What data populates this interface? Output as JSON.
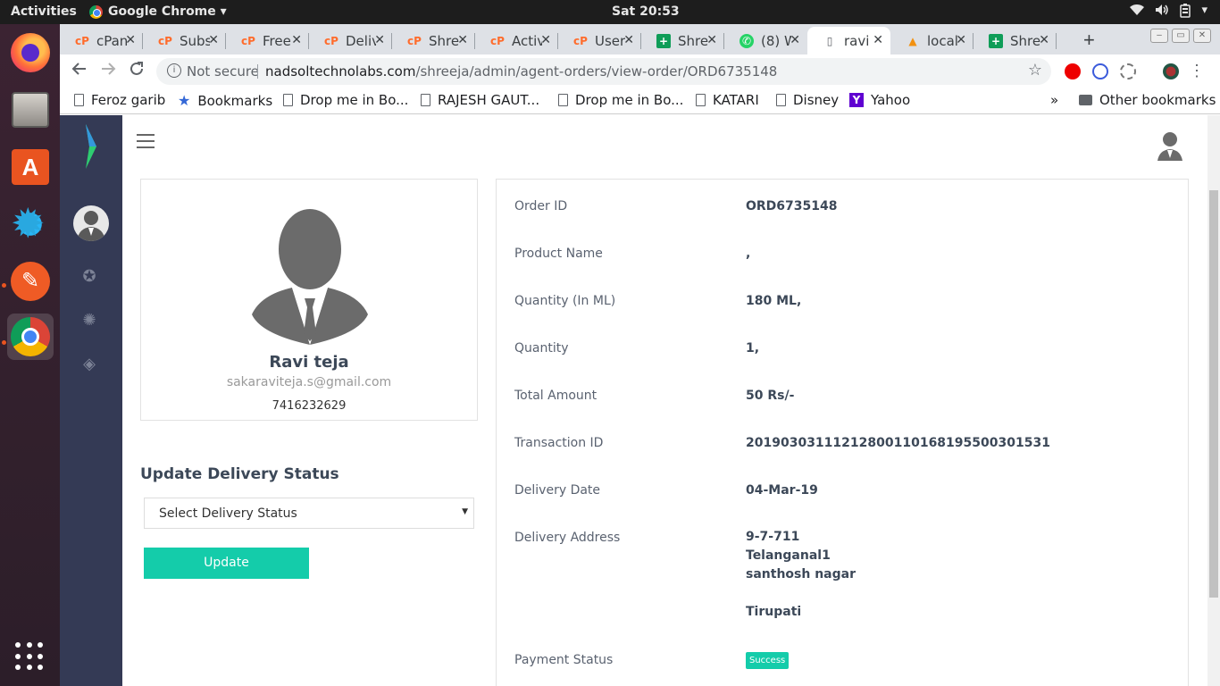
{
  "topbar": {
    "activities": "Activities",
    "app_name": "Google Chrome ▾",
    "clock": "Sat 20:53",
    "tray_icons": [
      "wifi-icon",
      "volume-icon",
      "battery-icon"
    ]
  },
  "tabs": [
    {
      "label": "cPan",
      "icon": "cpanel-icon"
    },
    {
      "label": "Subs",
      "icon": "cpanel-icon"
    },
    {
      "label": "Free",
      "icon": "cpanel-icon"
    },
    {
      "label": "Deliv",
      "icon": "cpanel-icon"
    },
    {
      "label": "Shre",
      "icon": "cpanel-icon"
    },
    {
      "label": "Activ",
      "icon": "cpanel-icon"
    },
    {
      "label": "User",
      "icon": "cpanel-icon"
    },
    {
      "label": "Shre",
      "icon": "sheets-icon"
    },
    {
      "label": "(8) W",
      "icon": "whatsapp-icon"
    },
    {
      "label": "ravi",
      "icon": "page-icon",
      "active": true
    },
    {
      "label": "local",
      "icon": "phpmyadmin-icon"
    },
    {
      "label": "Shre",
      "icon": "sheets-icon"
    }
  ],
  "omnibox": {
    "security": "Not secure",
    "domain": "nadsoltechnolabs.com",
    "path": "/shreeja/admin/agent-orders/view-order/ORD6735148"
  },
  "bookmarks": {
    "items": [
      {
        "label": "Feroz garib",
        "icon": "page-icon"
      },
      {
        "label": "Bookmarks",
        "icon": "star-icon"
      },
      {
        "label": "Drop me in Bo...",
        "icon": "page-icon"
      },
      {
        "label": "RAJESH GAUT...",
        "icon": "page-icon"
      },
      {
        "label": "Drop me in Bo...",
        "icon": "page-icon"
      },
      {
        "label": "KATARI",
        "icon": "page-icon"
      },
      {
        "label": "Disney",
        "icon": "page-icon"
      },
      {
        "label": "Yahoo",
        "icon": "yahoo-icon"
      }
    ],
    "overflow": "»",
    "other": "Other bookmarks"
  },
  "profile": {
    "name": "Ravi teja",
    "email": "sakaraviteja.s@gmail.com",
    "phone": "7416232629"
  },
  "delivery": {
    "title": "Update Delivery Status",
    "select_value": "Select Delivery Status",
    "button": "Update"
  },
  "order": {
    "rows": [
      {
        "label": "Order ID",
        "value": "ORD6735148"
      },
      {
        "label": "Product Name",
        "value": ","
      },
      {
        "label": "Quantity (In ML)",
        "value": "180 ML,"
      },
      {
        "label": "Quantity",
        "value": "1,"
      },
      {
        "label": "Total Amount",
        "value": "50 Rs/-"
      },
      {
        "label": "Transaction ID",
        "value": "20190303111212800110168195500301531"
      },
      {
        "label": "Delivery Date",
        "value": "04-Mar-19"
      }
    ],
    "address_label": "Delivery Address",
    "address": [
      "9-7-711",
      "Telanganal1",
      "santhosh nagar",
      "",
      "Tirupati"
    ],
    "payment_label": "Payment Status",
    "payment_value": "Success",
    "payment_color": "#14ccaa"
  }
}
